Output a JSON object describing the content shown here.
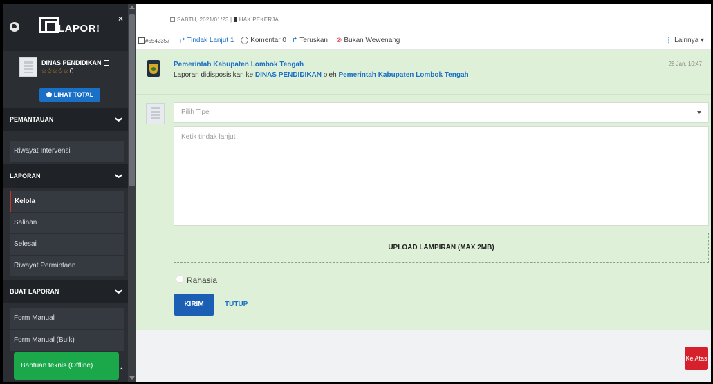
{
  "brand": {
    "logo_text": "LAPOR!",
    "close_glyph": "×"
  },
  "profile": {
    "org_name": "DINAS PENDIDIKAN",
    "stars": "☆☆☆☆☆",
    "score": "0",
    "total_button": "LIHAT TOTAL"
  },
  "sidebar": {
    "sections": [
      {
        "title": "PEMANTAUAN",
        "chevron": "❯",
        "items": [
          "Riwayat Intervensi"
        ]
      },
      {
        "title": "LAPORAN",
        "chevron": "❯",
        "items": [
          "Kelola",
          "Salinan",
          "Selesai",
          "Riwayat Permintaan"
        ]
      },
      {
        "title": "BUAT LAPORAN",
        "chevron": "❯",
        "items": [
          "Form Manual",
          "Form Manual (Bulk)"
        ]
      }
    ],
    "active_item": "Kelola"
  },
  "help_button": {
    "label": "Bantuan teknis (Offline)"
  },
  "header": {
    "date": "SABTU, 2021/01/23",
    "separator": "|",
    "rights": "HAK PEKERJA",
    "ticket_id": "#5542357"
  },
  "tabs": [
    {
      "icon": "⇄",
      "label": "Tindak Lanjut 1",
      "active": true
    },
    {
      "icon": "◯",
      "label": "Komentar 0",
      "active": false
    },
    {
      "icon": "↱",
      "label": "Teruskan",
      "active": false
    },
    {
      "icon": "⊘",
      "label": "Bukan Wewenang",
      "active": false
    }
  ],
  "more_menu": {
    "kebab": "⋮",
    "label": "Lainnya ▾"
  },
  "disposition": {
    "from": "Pemerintah Kabupaten Lombok Tengah",
    "text_prefix": "Laporan didisposisikan ke",
    "target": "DINAS PENDIDIKAN",
    "text_middle": "oleh",
    "by": "Pemerintah Kabupaten Lombok Tengah",
    "time": "26 Jan, 10:47"
  },
  "form": {
    "type_placeholder": "Pilih Tipe",
    "text_placeholder": "Ketik tindak lanjut",
    "upload_label": "UPLOAD LAMPIRAN (MAX 2MB)",
    "secret_label": "Rahasia",
    "send_button": "KIRIM",
    "close_button": "TUTUP"
  },
  "scroll_top": {
    "label": "Ke Atas"
  },
  "colors": {
    "accent": "#1a6fc6",
    "panel": "#dff0d8",
    "sidebar": "#2b2e33",
    "help": "#1aa84b",
    "danger": "#d6202b"
  }
}
